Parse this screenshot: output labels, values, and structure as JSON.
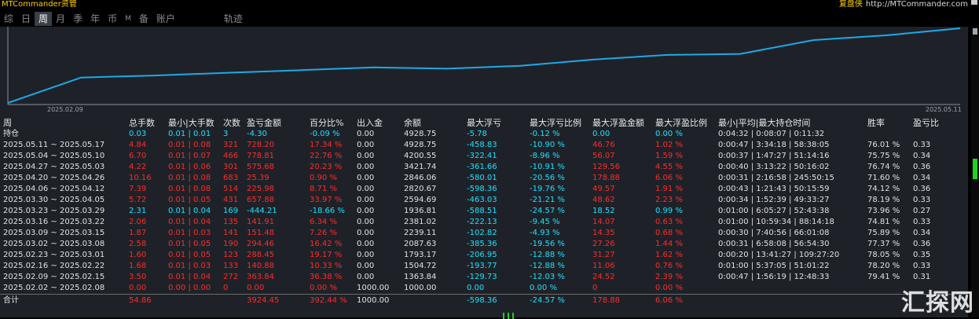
{
  "app": {
    "title": "MTCommander资管",
    "brand": "复盘侠",
    "url": "http://MTCommander.com"
  },
  "tabs": [
    {
      "label": "综",
      "active": false,
      "small": false
    },
    {
      "label": "日",
      "active": false,
      "small": false
    },
    {
      "label": "周",
      "active": true,
      "small": false
    },
    {
      "label": "月",
      "active": false,
      "small": false
    },
    {
      "label": "季",
      "active": false,
      "small": false
    },
    {
      "label": "年",
      "active": false,
      "small": false
    },
    {
      "label": "币",
      "active": false,
      "small": false
    },
    {
      "label": "M",
      "active": false,
      "small": true
    },
    {
      "label": "备",
      "active": false,
      "small": false
    },
    {
      "label": "账户",
      "active": false,
      "small": false
    },
    {
      "label": "轨迹",
      "active": false,
      "small": false,
      "gap": true
    }
  ],
  "chart_data": {
    "type": "line",
    "x_start_label": "2025.02.09",
    "x_end_label": "2025.05.11",
    "values": [
      0,
      1304.06,
      1408.59,
      1545.95,
      1681.14,
      1823.12,
      1756.04,
      1908.09,
      2224.38,
      2462.47,
      2516.59,
      3225.09,
      3470.64,
      3829.59
    ],
    "line_color": "#1fa8e8"
  },
  "table": {
    "headers": [
      "周",
      "总手数",
      "最小|大手数",
      "次数",
      "盈亏金额",
      "百分比%",
      "出入金",
      "余额",
      "最大浮亏",
      "最大浮亏比例",
      "最大浮盈金额",
      "最大浮盈比例",
      "最小|平均|最大持仓时间",
      "胜率",
      "盈亏比"
    ],
    "holding": {
      "label": "持仓",
      "color": "cyan",
      "cells": [
        "0.03",
        "0.01 | 0.01",
        "3",
        "-4.30",
        "-0.09 %",
        "0.00",
        "4928.75",
        "-5.78",
        "-0.12 %",
        "0.00",
        "0.00 %",
        "0:04:32 | 0:08:07 | 0:11:32",
        "",
        ""
      ]
    },
    "rows": [
      {
        "week": "2025.05.11 ~ 2025.05.17",
        "color": "red",
        "cells": [
          "4.84",
          "0.01 | 0.08",
          "321",
          "728.20",
          "17.34 %",
          "0.00",
          "4928.75",
          "-458.83",
          "-10.90 %",
          "46.76",
          "1.02 %",
          "0:00:47 | 3:34:18 | 58:38:05",
          "76.01 %",
          "0.33"
        ]
      },
      {
        "week": "2025.05.04 ~ 2025.05.10",
        "color": "red",
        "cells": [
          "6.70",
          "0.01 | 0.07",
          "466",
          "778.81",
          "22.76 %",
          "0.00",
          "4200.55",
          "-322.41",
          "-8.96 %",
          "56.07",
          "1.59 %",
          "0:00:37 | 1:47:27 | 51:14:16",
          "75.75 %",
          "0.34"
        ]
      },
      {
        "week": "2025.04.27 ~ 2025.05.03",
        "color": "red",
        "cells": [
          "4.22",
          "0.01 | 0.06",
          "301",
          "575.68",
          "20.23 %",
          "0.00",
          "3421.74",
          "-361.66",
          "-10.91 %",
          "129.56",
          "4.55 %",
          "0:00:40 | 3:13:22 | 50:16:02",
          "76.74 %",
          "0.36"
        ]
      },
      {
        "week": "2025.04.20 ~ 2025.04.26",
        "color": "red",
        "cells": [
          "10.16",
          "0.01 | 0.08",
          "683",
          "25.39",
          "0.90 %",
          "0.00",
          "2846.06",
          "-580.01",
          "-20.56 %",
          "178.88",
          "6.06 %",
          "0:00:31 | 2:16:58 | 245:50:15",
          "71.60 %",
          "0.34"
        ]
      },
      {
        "week": "2025.04.06 ~ 2025.04.12",
        "color": "red",
        "cells": [
          "7.39",
          "0.01 | 0.08",
          "514",
          "225.98",
          "8.71 %",
          "0.00",
          "2820.67",
          "-598.36",
          "-19.76 %",
          "49.57",
          "1.91 %",
          "0:00:43 | 1:21:43 | 50:15:59",
          "74.12 %",
          "0.36"
        ]
      },
      {
        "week": "2025.03.30 ~ 2025.04.05",
        "color": "red",
        "cells": [
          "5.72",
          "0.01 | 0.05",
          "431",
          "657.88",
          "33.97 %",
          "0.00",
          "2594.69",
          "-463.03",
          "-21.21 %",
          "48.62",
          "2.23 %",
          "0:00:34 | 1:52:39 | 49:33:27",
          "78.19 %",
          "0.33"
        ]
      },
      {
        "week": "2025.03.23 ~ 2025.03.29",
        "color": "cyan",
        "cells": [
          "2.31",
          "0.01 | 0.04",
          "169",
          "-444.21",
          "-18.66 %",
          "0.00",
          "1936.81",
          "-588.51",
          "-24.57 %",
          "18.52",
          "0.99 %",
          "0:01:00 | 6:05:27 | 52:43:38",
          "73.96 %",
          "0.27"
        ]
      },
      {
        "week": "2025.03.16 ~ 2025.03.22",
        "color": "red",
        "cells": [
          "2.06",
          "0.01 | 0.04",
          "135",
          "141.91",
          "6.34 %",
          "0.00",
          "2381.02",
          "-222.13",
          "-9.45 %",
          "14.07",
          "0.63 %",
          "0:01:00 | 10:59:34 | 88:14:18",
          "74.81 %",
          "0.33"
        ]
      },
      {
        "week": "2025.03.09 ~ 2025.03.15",
        "color": "red",
        "cells": [
          "1.87",
          "0.01 | 0.03",
          "141",
          "151.48",
          "7.26 %",
          "0.00",
          "2239.11",
          "-102.82",
          "-4.93 %",
          "14.35",
          "0.68 %",
          "0:00:30 | 7:40:56 | 66:01:08",
          "75.89 %",
          "0.34"
        ]
      },
      {
        "week": "2025.03.02 ~ 2025.03.08",
        "color": "red",
        "cells": [
          "2.58",
          "0.01 | 0.05",
          "190",
          "294.46",
          "16.42 %",
          "0.00",
          "2087.63",
          "-385.36",
          "-19.56 %",
          "27.26",
          "1.44 %",
          "0:00:31 | 6:58:08 | 56:54:30",
          "77.37 %",
          "0.36"
        ]
      },
      {
        "week": "2025.02.23 ~ 2025.03.01",
        "color": "red",
        "cells": [
          "1.60",
          "0.01 | 0.05",
          "123",
          "288.45",
          "19.17 %",
          "0.00",
          "1793.17",
          "-206.95",
          "-12.88 %",
          "31.27",
          "1.62 %",
          "0:00:20 | 13:41:27 | 109:27:20",
          "78.05 %",
          "0.35"
        ]
      },
      {
        "week": "2025.02.16 ~ 2025.02.22",
        "color": "red",
        "cells": [
          "1.68",
          "0.01 | 0.03",
          "133",
          "140.88",
          "10.33 %",
          "0.00",
          "1504.72",
          "-193.77",
          "-12.88 %",
          "11.06",
          "0.76 %",
          "0:01:00 | 5:37:05 | 51:01:22",
          "78.20 %",
          "0.33"
        ]
      },
      {
        "week": "2025.02.09 ~ 2025.02.15",
        "color": "red",
        "cells": [
          "3.50",
          "0.01 | 0.04",
          "272",
          "363.84",
          "36.38 %",
          "0.00",
          "1363.84",
          "-129.73",
          "-12.03 %",
          "24.52",
          "2.39 %",
          "0:00:47 | 1:56:19 | 12:48:33",
          "79.41 %",
          "0.31"
        ]
      },
      {
        "week": "2025.02.02 ~ 2025.02.08",
        "color": "red",
        "cells": [
          "0.00",
          "0.00 | 0.00",
          "0",
          "0.00",
          "0.00 %",
          "1000.00",
          "1000.00",
          "0.00",
          "0.00 %",
          "0",
          "0.00 %",
          "",
          "",
          ""
        ]
      }
    ],
    "total": {
      "label": "合计",
      "cells": [
        "54.86",
        "",
        "",
        "3924.45",
        "392.44 %",
        "1000.00",
        "",
        "-598.36",
        "-24.57 %",
        "178.88",
        "6.06 %",
        "",
        "",
        ""
      ]
    }
  },
  "watermark": "汇探网"
}
